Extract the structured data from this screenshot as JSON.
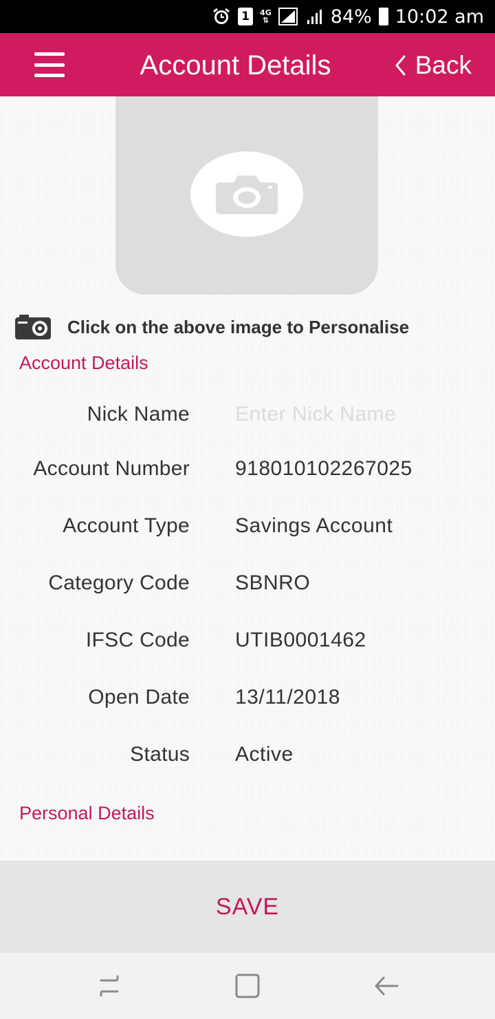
{
  "status_bar": {
    "sim_slot": "1",
    "network": "4G",
    "battery": "84%",
    "time": "10:02 am",
    "icons": [
      "alarm-icon",
      "sim-icon",
      "network-4g-icon",
      "signal-icon",
      "battery-icon"
    ]
  },
  "header": {
    "title": "Account Details",
    "back_label": "Back",
    "menu_icon": "hamburger-menu-icon",
    "back_icon": "chevron-left-icon"
  },
  "photo": {
    "icon": "camera-icon",
    "hint": "Click on the above image to Personalise"
  },
  "account_section": {
    "title": "Account Details",
    "nick_name": {
      "label": "Nick Name",
      "value": "",
      "placeholder": "Enter Nick Name"
    },
    "rows": [
      {
        "label": "Account Number",
        "value": "918010102267025"
      },
      {
        "label": "Account Type",
        "value": "Savings Account"
      },
      {
        "label": "Category Code",
        "value": "SBNRO"
      },
      {
        "label": "IFSC Code",
        "value": "UTIB0001462"
      },
      {
        "label": "Open Date",
        "value": "13/11/2018"
      },
      {
        "label": "Status",
        "value": "Active"
      }
    ]
  },
  "personal_section": {
    "title": "Personal Details"
  },
  "save_button": {
    "label": "SAVE"
  },
  "colors": {
    "brand": "#d01c5f",
    "section_title": "#c2185b",
    "text": "#333333",
    "save_bar": "#e5e5e5"
  },
  "nav_bar": {
    "icons": [
      "recent-apps-icon",
      "home-icon",
      "back-arrow-icon"
    ]
  }
}
